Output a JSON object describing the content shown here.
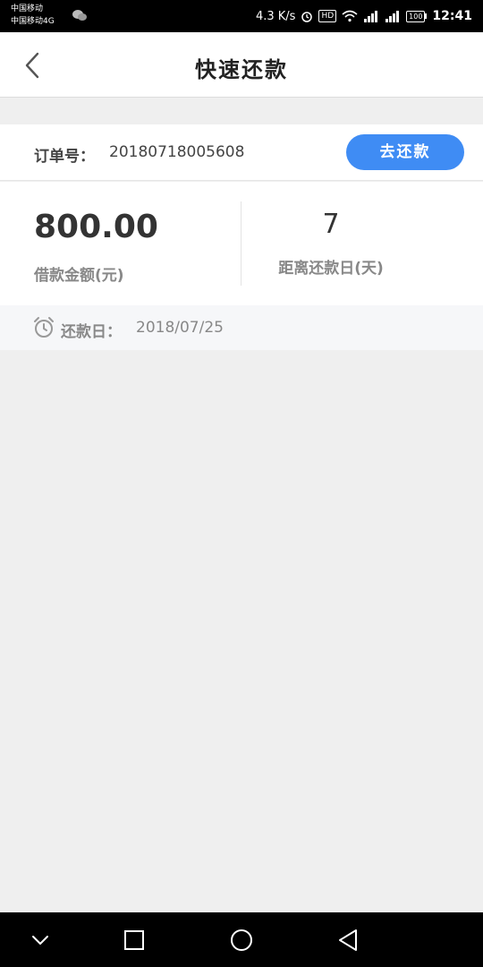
{
  "status_bar": {
    "carrier_1": "中国移动",
    "carrier_2": "中国移动4G",
    "speed": "4.3 K/s",
    "hd": "HD",
    "battery": "100",
    "time": "12:41"
  },
  "header": {
    "title": "快速还款"
  },
  "order": {
    "label": "订单号：",
    "number": "20180718005608",
    "button_label": "去还款"
  },
  "stats": {
    "amount_value": "800.00",
    "amount_label": "借款金额(元)",
    "days_value": "7",
    "days_label": "距离还款日(天)"
  },
  "due": {
    "label": "还款日：",
    "date": "2018/07/25"
  },
  "colors": {
    "accent": "#3f8cf4",
    "page_bg": "#efefef"
  },
  "icons": [
    "back-arrow-icon",
    "alarm-clock-icon",
    "nav-down-icon",
    "nav-square-icon",
    "nav-circle-icon",
    "nav-back-triangle-icon",
    "wechat-icon",
    "alarm-status-icon",
    "wifi-icon",
    "signal-icon",
    "battery-icon"
  ]
}
